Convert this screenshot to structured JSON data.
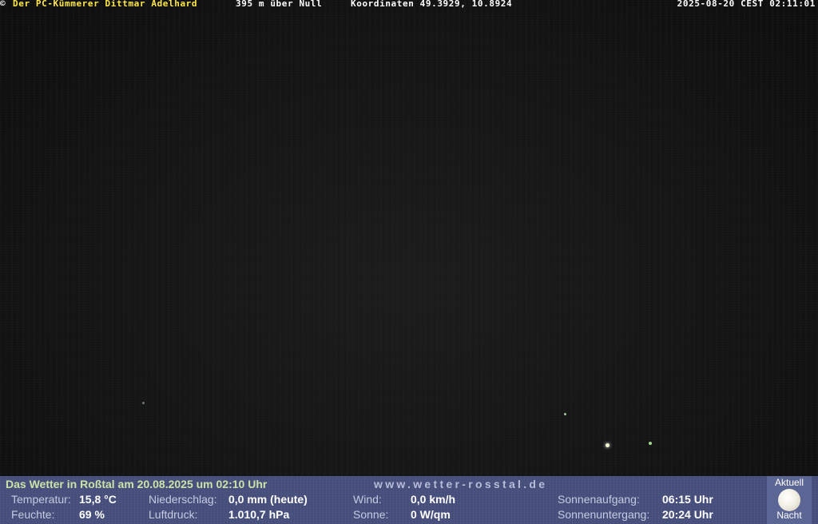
{
  "overlay": {
    "copyright": "©",
    "owner": "Der PC-Kümmerer Dittmar Adelhard",
    "altitude": "395 m über Null",
    "coordinates": "Koordinaten 49.3929, 10.8924",
    "timestamp": "2025-08-20 CEST 02:11:01"
  },
  "weather": {
    "title": "Das Wetter in Roßtal am 20.08.2025 um 02:10 Uhr",
    "website": "www.wetter-rosstal.de",
    "temperature": {
      "label": "Temperatur:",
      "value": "15,8 °C"
    },
    "humidity": {
      "label": "Feuchte:",
      "value": "69 %"
    },
    "precipitation": {
      "label": "Niederschlag:",
      "value": "0,0 mm (heute)"
    },
    "pressure": {
      "label": "Luftdruck:",
      "value": "1.010,7 hPa"
    },
    "wind": {
      "label": "Wind:",
      "value": "0,0 km/h"
    },
    "sun": {
      "label": "Sonne:",
      "value": "0 W/qm"
    },
    "sunrise": {
      "label": "Sonnenaufgang:",
      "value": "06:15 Uhr"
    },
    "sunset": {
      "label": "Sonnenuntergang:",
      "value": "20:24 Uhr"
    }
  },
  "moon": {
    "top_label": "Aktuell",
    "bottom_label": "Nacht",
    "icon": "moon-icon"
  }
}
